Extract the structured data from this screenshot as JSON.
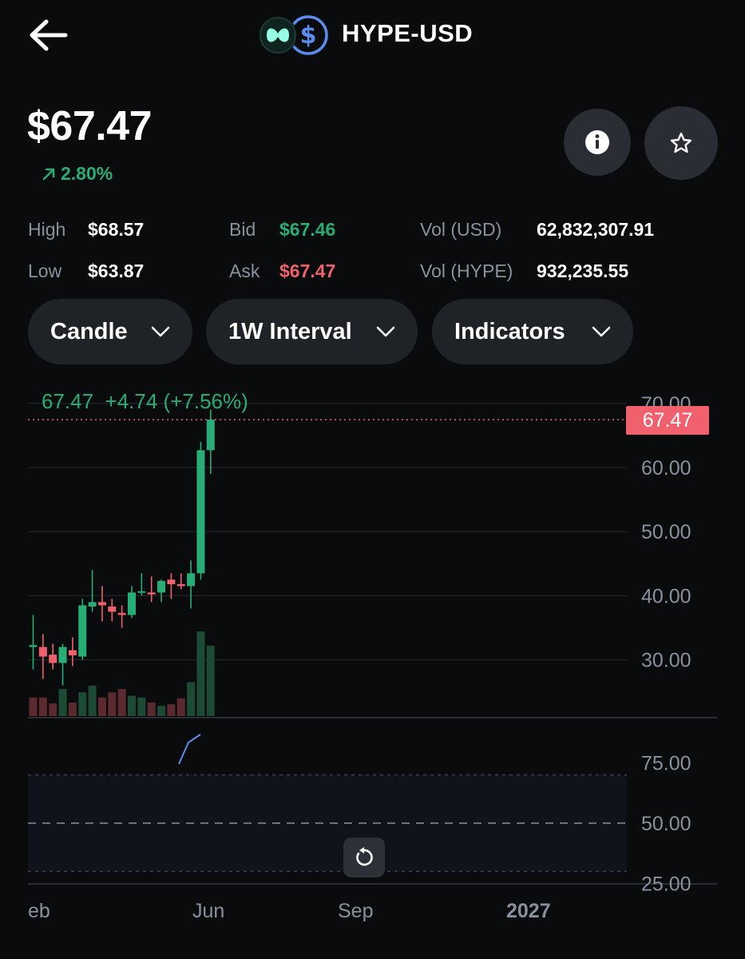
{
  "header": {
    "pair": "HYPE-USD",
    "back_icon": "arrow-left-icon",
    "logo_icons": [
      "hyperliquid-logo-icon",
      "usd-coin-icon"
    ]
  },
  "price": {
    "current": "$67.47",
    "change": "2.80%",
    "change_icon": "arrow-up-right-icon"
  },
  "stats": {
    "high_label": "High",
    "high_value": "$68.57",
    "low_label": "Low",
    "low_value": "$63.87",
    "bid_label": "Bid",
    "bid_value": "$67.46",
    "ask_label": "Ask",
    "ask_value": "$67.47",
    "vol_usd_label": "Vol (USD)",
    "vol_usd_value": "62,832,307.91",
    "vol_hype_label": "Vol (HYPE)",
    "vol_hype_value": "932,235.55"
  },
  "controls": {
    "chart_type": "Candle",
    "interval": "1W Interval",
    "indicators": "Indicators"
  },
  "chart_legend": {
    "close": "67.47",
    "change": "+4.74 (+7.56%)"
  },
  "price_tag": "67.47",
  "colors": {
    "up": "#27ad75",
    "down": "#f0616d",
    "background": "#0a0b0d",
    "rsi_line": "#5b8def"
  },
  "chart_data": {
    "type": "candlestick",
    "interval": "1W",
    "y_ticks": [
      "70.00",
      "60.00",
      "50.00",
      "40.00",
      "30.00"
    ],
    "x_ticks": [
      "eb",
      "Jun",
      "Sep",
      "2027"
    ],
    "ylim": [
      22,
      70
    ],
    "candles": [
      {
        "open": 32.0,
        "high": 37.0,
        "low": 28.5,
        "close": 32.3
      },
      {
        "open": 32.0,
        "high": 34.0,
        "low": 27.0,
        "close": 30.5
      },
      {
        "open": 30.8,
        "high": 32.5,
        "low": 28.5,
        "close": 29.5
      },
      {
        "open": 29.5,
        "high": 32.5,
        "low": 26.0,
        "close": 32.0
      },
      {
        "open": 31.5,
        "high": 33.5,
        "low": 29.0,
        "close": 30.7
      },
      {
        "open": 30.5,
        "high": 39.5,
        "low": 30.0,
        "close": 38.5
      },
      {
        "open": 38.3,
        "high": 44.0,
        "low": 37.5,
        "close": 39.0
      },
      {
        "open": 39.0,
        "high": 41.5,
        "low": 36.0,
        "close": 38.5
      },
      {
        "open": 38.3,
        "high": 39.5,
        "low": 36.0,
        "close": 37.5
      },
      {
        "open": 37.3,
        "high": 38.5,
        "low": 35.0,
        "close": 37.0
      },
      {
        "open": 37.0,
        "high": 41.5,
        "low": 36.5,
        "close": 40.5
      },
      {
        "open": 40.5,
        "high": 43.5,
        "low": 40.0,
        "close": 40.7
      },
      {
        "open": 40.5,
        "high": 43.0,
        "low": 39.0,
        "close": 40.2
      },
      {
        "open": 40.5,
        "high": 42.5,
        "low": 39.0,
        "close": 42.3
      },
      {
        "open": 42.5,
        "high": 43.5,
        "low": 39.5,
        "close": 41.8
      },
      {
        "open": 41.8,
        "high": 43.5,
        "low": 41.0,
        "close": 41.5
      },
      {
        "open": 41.5,
        "high": 45.5,
        "low": 38.0,
        "close": 43.5
      },
      {
        "open": 43.5,
        "high": 64.0,
        "low": 42.5,
        "close": 62.7
      },
      {
        "open": 62.7,
        "high": 69.0,
        "low": 59.0,
        "close": 67.47
      }
    ],
    "volume_up": [
      false,
      false,
      false,
      true,
      false,
      true,
      true,
      false,
      false,
      false,
      true,
      true,
      false,
      true,
      false,
      false,
      true,
      true,
      true
    ],
    "volume_heights": [
      0.22,
      0.22,
      0.15,
      0.32,
      0.16,
      0.28,
      0.36,
      0.22,
      0.28,
      0.32,
      0.24,
      0.22,
      0.16,
      0.12,
      0.14,
      0.21,
      0.4,
      1.0,
      0.83
    ],
    "current_price": 67.47,
    "rsi": {
      "y_ticks": [
        "75.00",
        "50.00",
        "25.00"
      ],
      "ylim": [
        25,
        75
      ],
      "band": [
        30,
        70
      ]
    }
  }
}
